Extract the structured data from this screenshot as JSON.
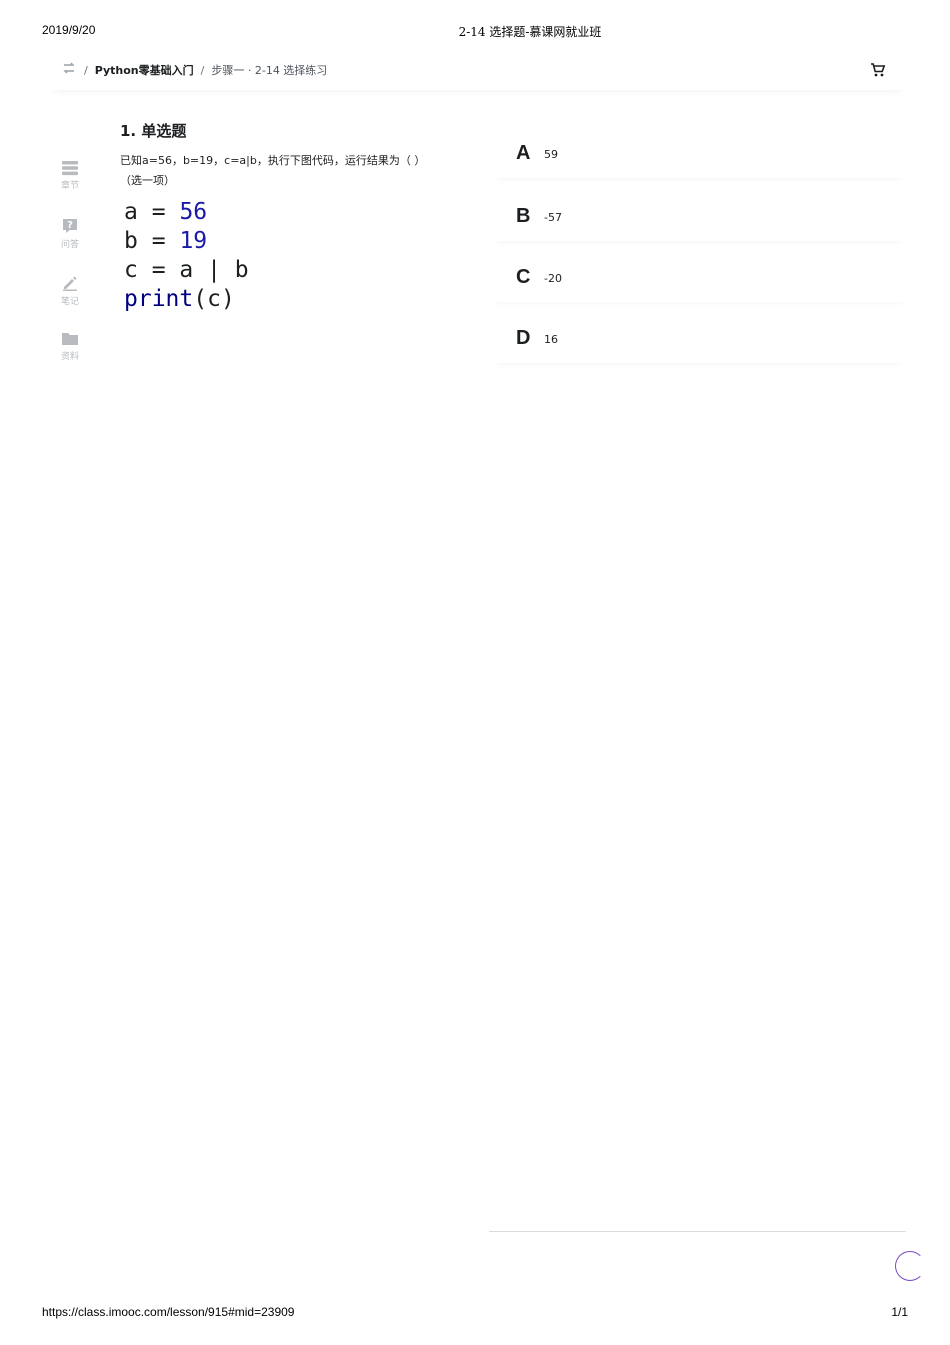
{
  "print_header": {
    "date": "2019/9/20",
    "title": "2-14 选择题-慕课网就业班"
  },
  "print_footer": {
    "url": "https://class.imooc.com/lesson/915#mid=23909",
    "page": "1/1"
  },
  "breadcrumb": {
    "separator": "/",
    "course": "Python零基础入门",
    "lesson": "步骤一 · 2-14 选择练习"
  },
  "sidebar": {
    "items": [
      {
        "label": "章节",
        "icon": "chapters-icon"
      },
      {
        "label": "问答",
        "icon": "question-icon"
      },
      {
        "label": "笔记",
        "icon": "pencil-icon"
      },
      {
        "label": "资料",
        "icon": "folder-icon"
      }
    ]
  },
  "question": {
    "title": "1. 单选题",
    "text": "已知a=56，b=19，c=a|b，执行下图代码，运行结果为（ ）（选一项）",
    "code": {
      "line1": {
        "name": "a",
        "op": "=",
        "value": "56"
      },
      "line2": {
        "name": "b",
        "op": "=",
        "value": "19"
      },
      "line3": {
        "text": "c = a | b"
      },
      "line4": {
        "fn": "print",
        "arg": "(c)"
      }
    }
  },
  "options": [
    {
      "letter": "A",
      "text": "59"
    },
    {
      "letter": "B",
      "text": "-57"
    },
    {
      "letter": "C",
      "text": "-20"
    },
    {
      "letter": "D",
      "text": "16"
    }
  ],
  "colors": {
    "accent": "#7b4ec9",
    "code_number": "#1a1aa6",
    "code_keyword": "#000080"
  }
}
